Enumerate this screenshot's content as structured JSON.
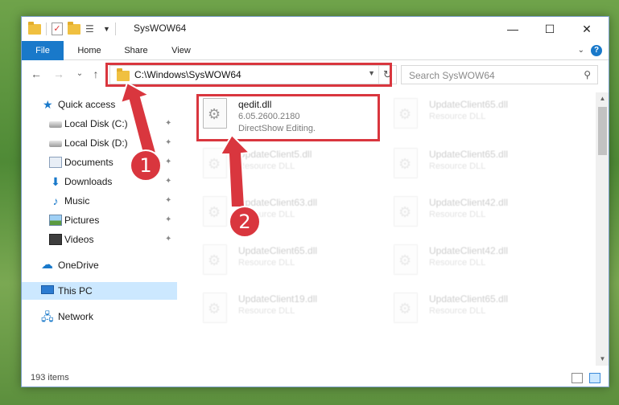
{
  "window": {
    "title": "SysWOW64",
    "controls": {
      "minimize": "—",
      "maximize": "☐",
      "close": "✕"
    }
  },
  "ribbon": {
    "tabs": [
      "File",
      "Home",
      "Share",
      "View"
    ],
    "expand": "⌄",
    "help": "?"
  },
  "nav": {
    "back": "←",
    "forward": "→",
    "recent": "⌄",
    "up": "↑",
    "address": "C:\\Windows\\SysWOW64",
    "search_placeholder": "Search SysWOW64"
  },
  "sidebar": {
    "items": [
      {
        "label": "Quick access",
        "icon": "star-icon",
        "pinned": false
      },
      {
        "label": "Local Disk (C:)",
        "icon": "disk-icon",
        "pinned": true
      },
      {
        "label": "Local Disk (D:)",
        "icon": "disk-icon",
        "pinned": true
      },
      {
        "label": "Documents",
        "icon": "documents-icon",
        "pinned": true
      },
      {
        "label": "Downloads",
        "icon": "download-icon",
        "pinned": true
      },
      {
        "label": "Music",
        "icon": "music-icon",
        "pinned": true
      },
      {
        "label": "Pictures",
        "icon": "pictures-icon",
        "pinned": true
      },
      {
        "label": "Videos",
        "icon": "videos-icon",
        "pinned": true
      },
      {
        "label": "OneDrive",
        "icon": "cloud-icon",
        "pinned": false
      },
      {
        "label": "This PC",
        "icon": "pc-icon",
        "pinned": false
      },
      {
        "label": "Network",
        "icon": "network-icon",
        "pinned": false
      }
    ],
    "pin_glyph": "📌"
  },
  "files": {
    "highlighted": {
      "name": "qedit.dll",
      "version": "6.05.2600.2180",
      "description": "DirectShow Editing."
    },
    "left_column": [
      {
        "name": "UpdateClient5.dll",
        "type": "Resource DLL"
      },
      {
        "name": "UpdateClient63.dll",
        "type": "Resource DLL"
      },
      {
        "name": "UpdateClient65.dll",
        "type": "Resource DLL"
      },
      {
        "name": "UpdateClient19.dll",
        "type": "Resource DLL"
      }
    ],
    "right_column": [
      {
        "name": "UpdateClient65.dll",
        "type": "Resource DLL"
      },
      {
        "name": "UpdateClient65.dll",
        "type": "Resource DLL"
      },
      {
        "name": "UpdateClient42.dll",
        "type": "Resource DLL"
      },
      {
        "name": "UpdateClient42.dll",
        "type": "Resource DLL"
      },
      {
        "name": "UpdateClient65.dll",
        "type": "Resource DLL"
      }
    ]
  },
  "status": {
    "item_count": "193 items"
  },
  "annotations": {
    "step1": "1",
    "step2": "2",
    "color": "#d9363e"
  }
}
